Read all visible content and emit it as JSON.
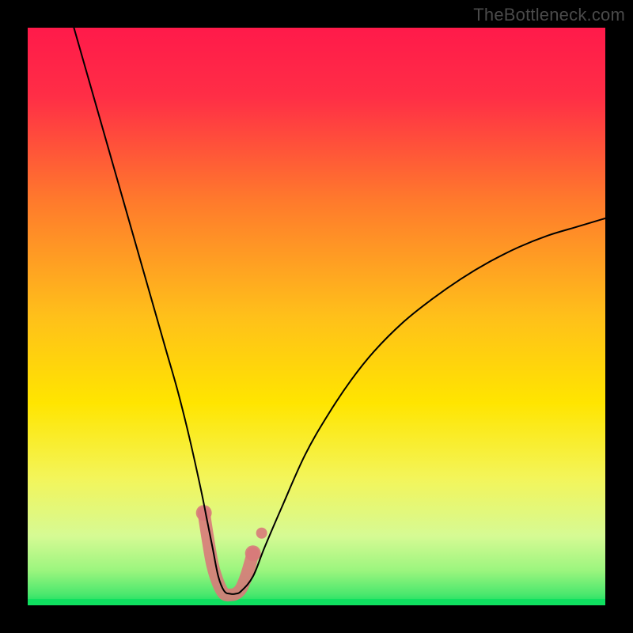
{
  "watermark": "TheBottleneck.com",
  "chart_data": {
    "type": "line",
    "title": "",
    "xlabel": "",
    "ylabel": "",
    "xlim": [
      0,
      100
    ],
    "ylim": [
      0,
      100
    ],
    "background_gradient": {
      "direction": "vertical",
      "stops": [
        {
          "pct": 0,
          "color": "#ff1a4a"
        },
        {
          "pct": 12,
          "color": "#ff2e46"
        },
        {
          "pct": 30,
          "color": "#ff7a2c"
        },
        {
          "pct": 50,
          "color": "#ffc01a"
        },
        {
          "pct": 65,
          "color": "#ffe500"
        },
        {
          "pct": 78,
          "color": "#f3f55a"
        },
        {
          "pct": 88,
          "color": "#d6fa94"
        },
        {
          "pct": 94,
          "color": "#9bf57e"
        },
        {
          "pct": 98,
          "color": "#4de86e"
        },
        {
          "pct": 100,
          "color": "#10e060"
        }
      ]
    },
    "series": [
      {
        "name": "bottleneck-curve",
        "color": "#000000",
        "stroke_width": 2,
        "x": [
          8,
          10,
          12,
          14,
          16,
          18,
          20,
          22,
          24,
          26,
          28,
          30,
          31,
          32,
          33,
          34,
          35,
          36,
          37,
          39,
          41,
          44,
          48,
          52,
          56,
          60,
          65,
          70,
          75,
          80,
          85,
          90,
          95,
          100
        ],
        "y": [
          100,
          93,
          86,
          79,
          72,
          65,
          58,
          51,
          44,
          37,
          29,
          20,
          15,
          10,
          5,
          2.5,
          2,
          2,
          2.5,
          5,
          10,
          17,
          26,
          33,
          39,
          44,
          49,
          53,
          56.5,
          59.5,
          62,
          64,
          65.5,
          67
        ]
      }
    ],
    "highlight": {
      "name": "trough-highlight",
      "color": "#d87a7a",
      "style": "beaded-thick",
      "opacity": 0.9,
      "x": [
        30.5,
        31.2,
        32.0,
        33.0,
        34.0,
        35.0,
        36.0,
        37.0,
        38.0,
        39.0
      ],
      "y": [
        16.0,
        11.5,
        7.0,
        3.8,
        2.0,
        1.8,
        2.0,
        3.0,
        5.5,
        9.0
      ]
    },
    "highlight_dot": {
      "x": 40.5,
      "y": 12.5,
      "color": "#d87a7a"
    }
  }
}
